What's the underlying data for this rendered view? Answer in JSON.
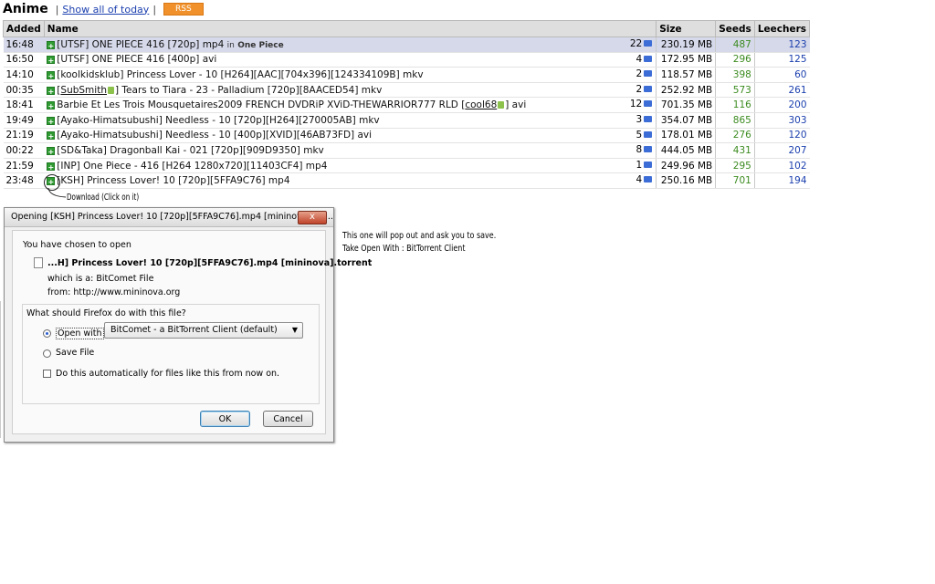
{
  "header": {
    "title": "Anime",
    "show_all_link": "Show all of today",
    "rss_label": "RSS"
  },
  "table": {
    "columns": [
      "Added",
      "Name",
      "Size",
      "Seeds",
      "Leechers"
    ],
    "rows": [
      {
        "added": "16:48",
        "name": "[UTSF] ONE PIECE 416 [720p] mp4",
        "in_prefix": "in",
        "in_label": "One Piece",
        "comments": "22",
        "size": "230.19 MB",
        "seeds": "487",
        "leechers": "123"
      },
      {
        "added": "16:50",
        "name": "[UTSF] ONE PIECE 416 [400p] avi",
        "comments": "4",
        "size": "172.95 MB",
        "seeds": "296",
        "leechers": "125"
      },
      {
        "added": "14:10",
        "name": "[koolkidsklub] Princess Lover - 10 [H264][AAC][704x396][124334109B] mkv",
        "comments": "2",
        "size": "118.57 MB",
        "seeds": "398",
        "leechers": "60"
      },
      {
        "added": "00:35",
        "name_pre": "[",
        "name_user": "SubSmith",
        "name_post": "] Tears to Tiara - 23 - Palladium [720p][8AACED54] mkv",
        "comments": "2",
        "size": "252.92 MB",
        "seeds": "573",
        "leechers": "261"
      },
      {
        "added": "18:41",
        "name_pre": "Barbie Et Les Trois Mousquetaires2009 FRENCH DVDRiP XViD-THEWARRIOR777 RLD [",
        "name_user": "cool68",
        "name_post": "] avi",
        "comments": "12",
        "size": "701.35 MB",
        "seeds": "116",
        "leechers": "200"
      },
      {
        "added": "19:49",
        "name": "[Ayako-Himatsubushi] Needless - 10 [720p][H264][270005AB] mkv",
        "comments": "3",
        "size": "354.07 MB",
        "seeds": "865",
        "leechers": "303"
      },
      {
        "added": "21:19",
        "name": "[Ayako-Himatsubushi] Needless - 10 [400p][XVID][46AB73FD] avi",
        "comments": "5",
        "size": "178.01 MB",
        "seeds": "276",
        "leechers": "120"
      },
      {
        "added": "00:22",
        "name": "[SD&Taka] Dragonball Kai - 021 [720p][909D9350] mkv",
        "comments": "8",
        "size": "444.05 MB",
        "seeds": "431",
        "leechers": "207"
      },
      {
        "added": "21:59",
        "name": "[INP] One Piece - 416 [H264 1280x720][11403CF4] mp4",
        "comments": "1",
        "size": "249.96 MB",
        "seeds": "295",
        "leechers": "102"
      },
      {
        "added": "23:48",
        "name": "[KSH] Princess Lover! 10 [720p][5FFA9C76] mp4",
        "comments": "4",
        "size": "250.16 MB",
        "seeds": "701",
        "leechers": "194"
      }
    ]
  },
  "annotations": {
    "download_hint": "Download (Click on it)",
    "popup_line1": "This one will pop out and ask you to save.",
    "popup_line2": "Take Open With : BitTorrent Client"
  },
  "dialog": {
    "title": "Opening [KSH] Princess Lover! 10 [720p][5FFA9C76].mp4 [mininova].tor...",
    "close_label": "x",
    "chosen_text": "You have chosen to open",
    "file_name": "...H] Princess Lover! 10 [720p][5FFA9C76].mp4 [mininova].torrent",
    "which_is": "which is a:  BitComet File",
    "from": "from:  http://www.mininova.org",
    "question": "What should Firefox do with this file?",
    "open_with_label": "Open with",
    "open_with_app": "BitComet - a BitTorrent Client (default)",
    "save_file_label": "Save File",
    "auto_label": "Do this automatically for files like this from now on.",
    "ok_label": "OK",
    "cancel_label": "Cancel"
  },
  "icons": {
    "download": "download-plus-icon",
    "comment": "comment-bubble-icon",
    "trusted": "trusted-user-icon"
  },
  "colors": {
    "seeds": "#3b8b1f",
    "leechers": "#1b3fae",
    "rss": "#f0912b",
    "highlight_row": "#d6d9ea"
  }
}
